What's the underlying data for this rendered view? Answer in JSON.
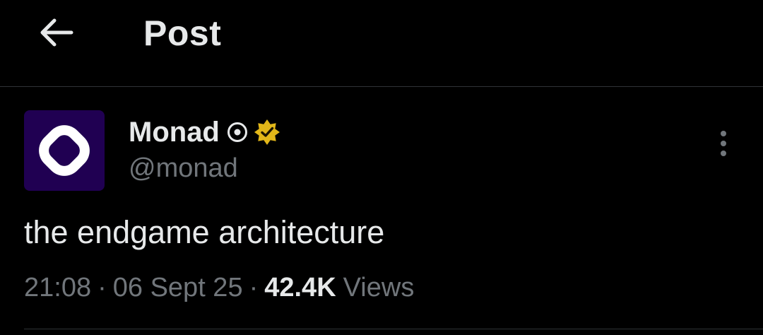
{
  "header": {
    "title": "Post",
    "back_icon": "arrow-left-icon"
  },
  "post": {
    "author": {
      "display_name": "Monad",
      "handle": "@monad",
      "avatar_bg": "#200052",
      "avatar_icon": "monad-logo-icon",
      "affiliation_icon": "affiliate-badge-icon",
      "verified_icon": "verified-gold-badge-icon",
      "verified_color": "#e2b719"
    },
    "text": "the endgame architecture",
    "time": "21:08",
    "date": "06 Sept 25",
    "views_count": "42.4K",
    "views_label": "Views",
    "separator": "·",
    "more_icon": "more-vertical-icon"
  },
  "colors": {
    "background": "#000000",
    "primary_text": "#e7e9ea",
    "secondary_text": "#71767b",
    "divider": "#2f3336"
  }
}
